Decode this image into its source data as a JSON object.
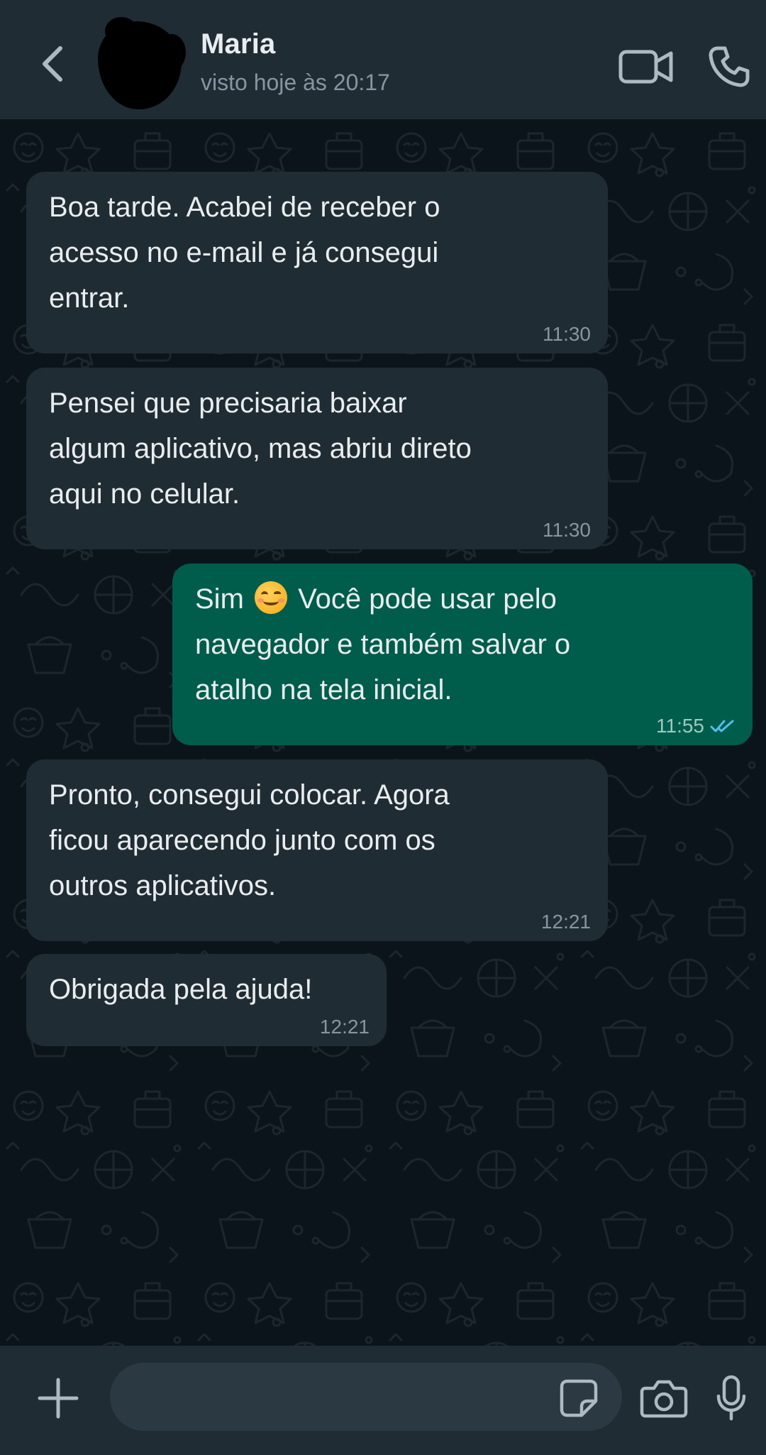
{
  "header": {
    "contact_name": "Maria",
    "status": "visto hoje às 20:17",
    "icons": {
      "back": "chevron-left-icon",
      "video": "video-camera-icon",
      "call": "phone-icon"
    }
  },
  "messages": [
    {
      "direction": "in",
      "text": "Boa tarde. Acabei de receber o\nacesso no e-mail e já consegui\nentrar.",
      "time": "11:30"
    },
    {
      "direction": "in",
      "text": "Pensei que precisaria baixar\nalgum aplicativo, mas abriu direto\naqui no celular.",
      "time": "11:30"
    },
    {
      "direction": "out",
      "text_before_emoji": "Sim",
      "emoji": "smiling-face-emoji",
      "text_after_emoji": "Você pode usar pelo\nnavegador e também salvar o\natalho na tela inicial.",
      "time": "11:55",
      "status": "read"
    },
    {
      "direction": "in",
      "text": "Pronto, consegui colocar. Agora\nficou aparecendo junto com os\noutros aplicativos.",
      "time": "12:21"
    },
    {
      "direction": "in",
      "text": "Obrigada pela ajuda!",
      "time": "12:21"
    }
  ],
  "input_bar": {
    "placeholder": "",
    "icons": {
      "attach": "plus-icon",
      "sticker": "sticker-icon",
      "camera": "camera-icon",
      "mic": "microphone-icon"
    }
  },
  "colors": {
    "header_bg": "#1f2c34",
    "chat_bg": "#0b141a",
    "incoming_bubble": "#202c33",
    "outgoing_bubble": "#005c4b",
    "read_ticks": "#53bdeb"
  }
}
